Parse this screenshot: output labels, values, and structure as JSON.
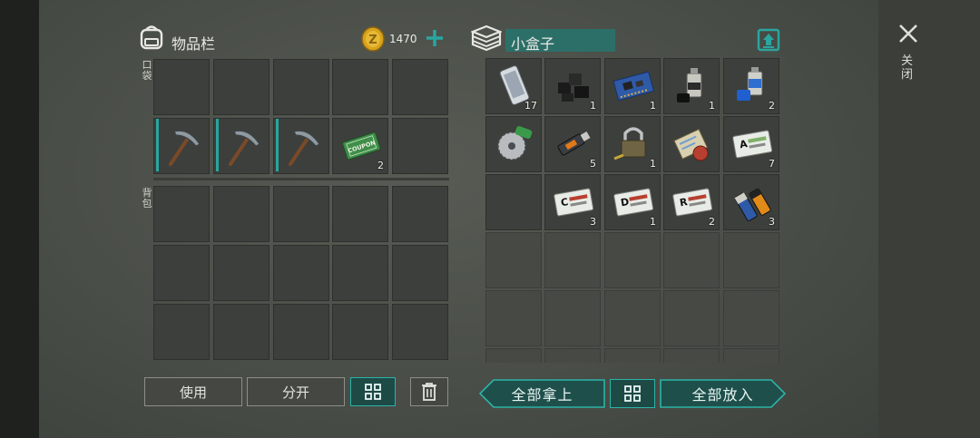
{
  "inventory": {
    "title": "物品栏",
    "coins": "1470",
    "pocket_label": "口袋",
    "backpack_label": "背包",
    "pocket_items": [
      {
        "icon": "pickaxe-icon",
        "count": ""
      },
      {
        "icon": "pickaxe-icon",
        "count": ""
      },
      {
        "icon": "pickaxe-icon",
        "count": ""
      },
      {
        "icon": "coupon-icon",
        "count": "2"
      }
    ],
    "buttons": {
      "use": "使用",
      "split": "分开"
    }
  },
  "container": {
    "name": "小盒子",
    "items": [
      {
        "icon": "phone-icon",
        "count": "17"
      },
      {
        "icon": "coal-icon",
        "count": "1"
      },
      {
        "icon": "circuit-board-icon",
        "count": "1"
      },
      {
        "icon": "spray-can-icon",
        "count": "1"
      },
      {
        "icon": "blue-spray-can-icon",
        "count": "2"
      },
      {
        "icon": "saw-blade-icon",
        "count": ""
      },
      {
        "icon": "usb-drive-icon",
        "count": "5"
      },
      {
        "icon": "padlock-icon",
        "count": "1"
      },
      {
        "icon": "map-scroll-icon",
        "count": ""
      },
      {
        "icon": "card-a-icon",
        "count": "7"
      },
      {
        "icon": "empty",
        "count": ""
      },
      {
        "icon": "card-c-icon",
        "count": "3"
      },
      {
        "icon": "card-d-icon",
        "count": "1"
      },
      {
        "icon": "card-r-icon",
        "count": "2"
      },
      {
        "icon": "batteries-icon",
        "count": "3"
      }
    ],
    "buttons": {
      "take_all": "全部拿上",
      "put_all": "全部放入"
    }
  },
  "close_label": "关闭",
  "colors": {
    "accent": "#2aa6a0",
    "gold": "#d7a21c"
  }
}
